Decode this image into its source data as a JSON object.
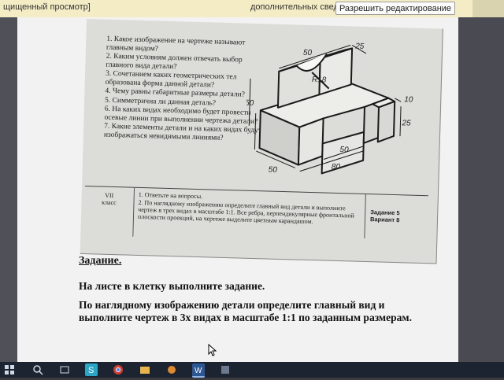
{
  "infobar": {
    "left_text": "щищенный просмотр]",
    "right_text": "дополнительных сведений.",
    "enable_button": "Разрешить редактирование"
  },
  "scan": {
    "questions": [
      "1. Какое изображение на чертеже называют главным видом?",
      "2. Каким условиям должен отвечать выбор главного вида детали?",
      "3. Сочетанием каких геометрических тел образована форма данной детали?",
      "4. Чему равны габаритные размеры детали?",
      "5. Симметрична ли данная деталь?",
      "6. На каких видах необходимо будет провести осевые линии при выполнении чертежа детали?",
      "7. Какие элементы детали и на каких видах будут изображаться невидимыми линиями?"
    ],
    "figure_dims": [
      "50",
      "25",
      "R18",
      "10",
      "50",
      "25",
      "50",
      "80",
      "50"
    ],
    "table": {
      "class_label": [
        "VII",
        "класс"
      ],
      "tasks": [
        "1. Ответьте на вопросы.",
        "2. По наглядному изображению определите главный вид детали и выполните чертеж в трех видах в масштабе 1:1. Все ребра, перпендикулярные фронтальной плоскости проекций, на чертеже выделите цветным карандашом."
      ],
      "variant": [
        "Задание 5",
        "Вариант 8"
      ]
    }
  },
  "document": {
    "heading": "Задание.",
    "para1": "На листе в клетку выполните задание.",
    "para2": "По наглядному изображению детали определите главный вид и выполните чертеж в 3х видах в масштабе 1:1 по заданным размерам."
  },
  "taskbar": {
    "items": [
      "start-icon",
      "search-icon",
      "task-view-icon",
      "edge-icon",
      "explorer-icon",
      "skype-icon",
      "chrome-icon",
      "app-icon",
      "word-icon",
      "app-icon-2"
    ]
  },
  "colors": {
    "infobar_bg": "#f3ecc4",
    "taskbar_bg": "#1c2331",
    "word_blue": "#2b5797"
  }
}
